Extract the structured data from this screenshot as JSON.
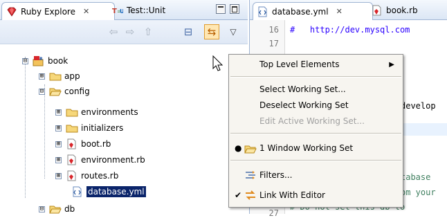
{
  "left_view": {
    "tabs": [
      {
        "label": "Ruby Explore",
        "icon": "ruby-gem-icon",
        "close": "✕",
        "active": true
      },
      {
        "label": "Test::Unit",
        "icon": "test-unit-icon",
        "active": false
      }
    ]
  },
  "toolbar": {
    "buttons": [
      {
        "name": "back-icon",
        "glyph": "⇦"
      },
      {
        "name": "forward-icon",
        "glyph": "⇨"
      },
      {
        "name": "up-icon",
        "glyph": "⇧"
      },
      {
        "name": "collapse-all-icon",
        "glyph": "⊟"
      },
      {
        "name": "link-with-editor-icon",
        "glyph": "⇆"
      },
      {
        "name": "view-menu-icon",
        "glyph": "▽"
      }
    ]
  },
  "tree": {
    "nodes": [
      {
        "label": "book",
        "expander": "⊟",
        "icon": "ruby-project-icon"
      },
      {
        "label": "app",
        "expander": "⊞",
        "icon": "folder-icon"
      },
      {
        "label": "config",
        "expander": "⊟",
        "icon": "folder-open-icon"
      },
      {
        "label": "environments",
        "expander": "⊞",
        "icon": "folder-icon"
      },
      {
        "label": "initializers",
        "expander": "⊞",
        "icon": "folder-icon"
      },
      {
        "label": "boot.rb",
        "expander": "⊞",
        "icon": "ruby-file-icon"
      },
      {
        "label": "environment.rb",
        "expander": "⊞",
        "icon": "ruby-file-icon"
      },
      {
        "label": "routes.rb",
        "expander": "⊞",
        "icon": "ruby-file-icon"
      },
      {
        "label": "database.yml",
        "expander": "",
        "icon": "yaml-file-icon",
        "selected": true
      },
      {
        "label": "db",
        "expander": "⊟",
        "icon": "folder-open-icon"
      }
    ]
  },
  "editor": {
    "tabs": [
      {
        "label": "database.yml",
        "close": "✕",
        "active": true
      },
      {
        "label": "book.rb",
        "active": false
      }
    ],
    "lines": [
      {
        "number": "16",
        "text": "#   http://dev.mysql.com",
        "kind": "url"
      },
      {
        "number": "17",
        "text": "",
        "kind": "comment"
      },
      {
        "number": "",
        "text": "",
        "kind": "comment"
      },
      {
        "number": "",
        "text": "develop",
        "kind": "plain"
      },
      {
        "number": "",
        "text": "",
        "kind": "plain"
      },
      {
        "number": "",
        "text": "",
        "kind": "plain"
      },
      {
        "number": "",
        "text": "tabase",
        "kind": "comment"
      },
      {
        "number": "",
        "text": "om your",
        "kind": "comment"
      },
      {
        "number": "27",
        "text": "# Do not set this db to",
        "kind": "comment"
      }
    ]
  },
  "menu": {
    "items": [
      {
        "label": "Top Level Elements",
        "submenu": "▶",
        "disabled": false
      },
      {
        "label": "Select Working Set...",
        "disabled": false
      },
      {
        "label": "Deselect Working Set",
        "disabled": false
      },
      {
        "label": "Edit Active Working Set...",
        "disabled": true
      },
      {
        "label": "1 Window Working Set",
        "mark": "●",
        "icon": "working-set-icon",
        "disabled": false
      },
      {
        "label": "Filters...",
        "icon": "filter-icon",
        "disabled": false
      },
      {
        "label": "Link With Editor",
        "mark": "✔",
        "icon": "link-with-editor-icon",
        "disabled": false
      }
    ]
  }
}
